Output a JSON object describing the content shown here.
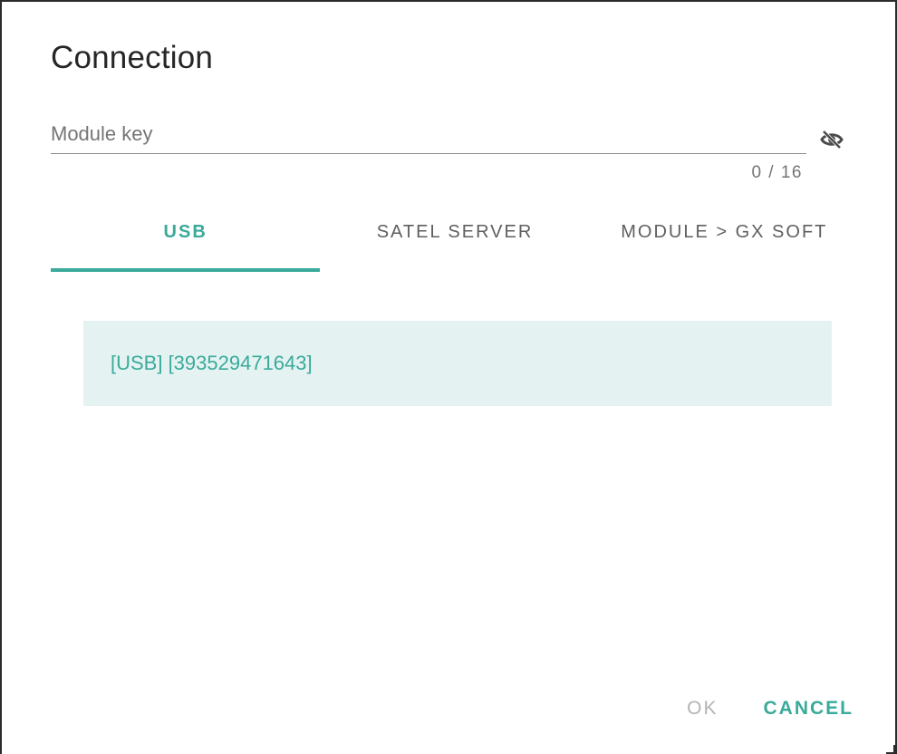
{
  "dialog": {
    "title": "Connection"
  },
  "module_key": {
    "placeholder": "Module key",
    "value": "",
    "counter": "0 / 16",
    "visibility_icon": "eye-off-icon"
  },
  "tabs": [
    {
      "label": "USB",
      "active": true
    },
    {
      "label": "SATEL SERVER",
      "active": false
    },
    {
      "label": "MODULE > GX SOFT",
      "active": false
    }
  ],
  "devices": [
    {
      "label": "[USB] [393529471643]"
    }
  ],
  "actions": {
    "ok_label": "OK",
    "cancel_label": "CANCEL"
  },
  "colors": {
    "accent": "#3aaa9a",
    "selected_item_bg": "#e4f3f2",
    "disabled_text": "#b3b3b3"
  }
}
